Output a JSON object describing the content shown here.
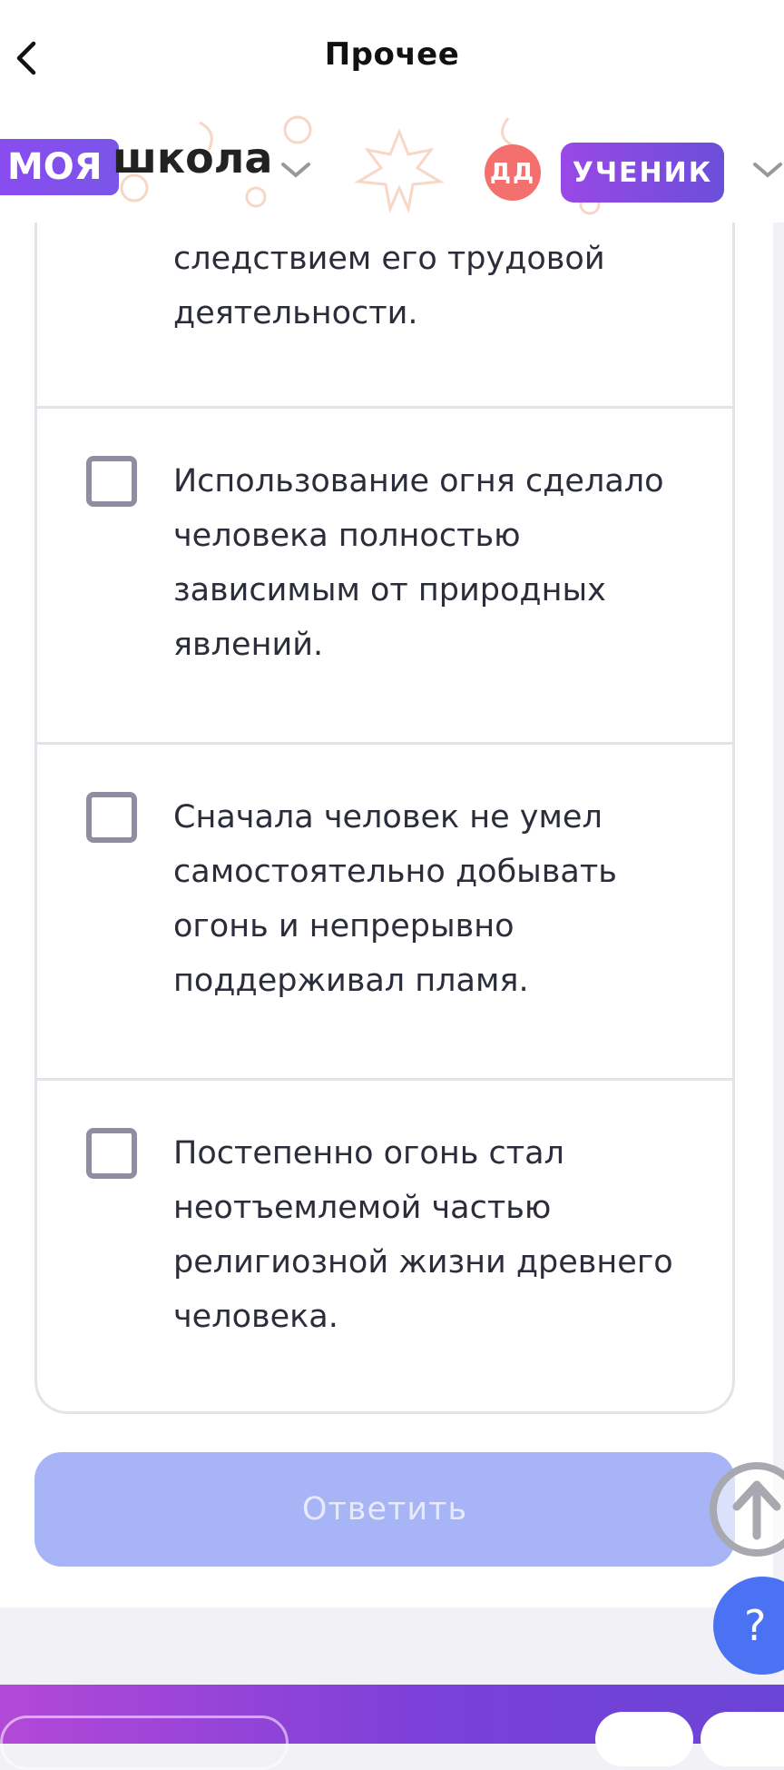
{
  "header": {
    "title": "Прочее",
    "back_icon": "chevron-left-icon"
  },
  "brand": {
    "badge": "МОЯ",
    "name": "школа",
    "avatar_initials": "ДД",
    "role": "УЧЕНИК",
    "accent_color": "#7a55e8"
  },
  "options": [
    {
      "text": "следствием его трудовой деятельности.",
      "partial": true
    },
    {
      "text": "Использование огня сделало человека полностью зависимым от природных явлений."
    },
    {
      "text": "Сначала человек не умел самостоятельно добывать огонь и непрерывно поддерживал пламя."
    },
    {
      "text": "Постепенно огонь стал неотъемлемой частью религиозной жизни древнего человека."
    }
  ],
  "submit": {
    "label": "Ответить",
    "color": "#a7b4f6"
  },
  "fab": {
    "scroll_top_icon": "arrow-up-icon",
    "help_label": "?"
  }
}
